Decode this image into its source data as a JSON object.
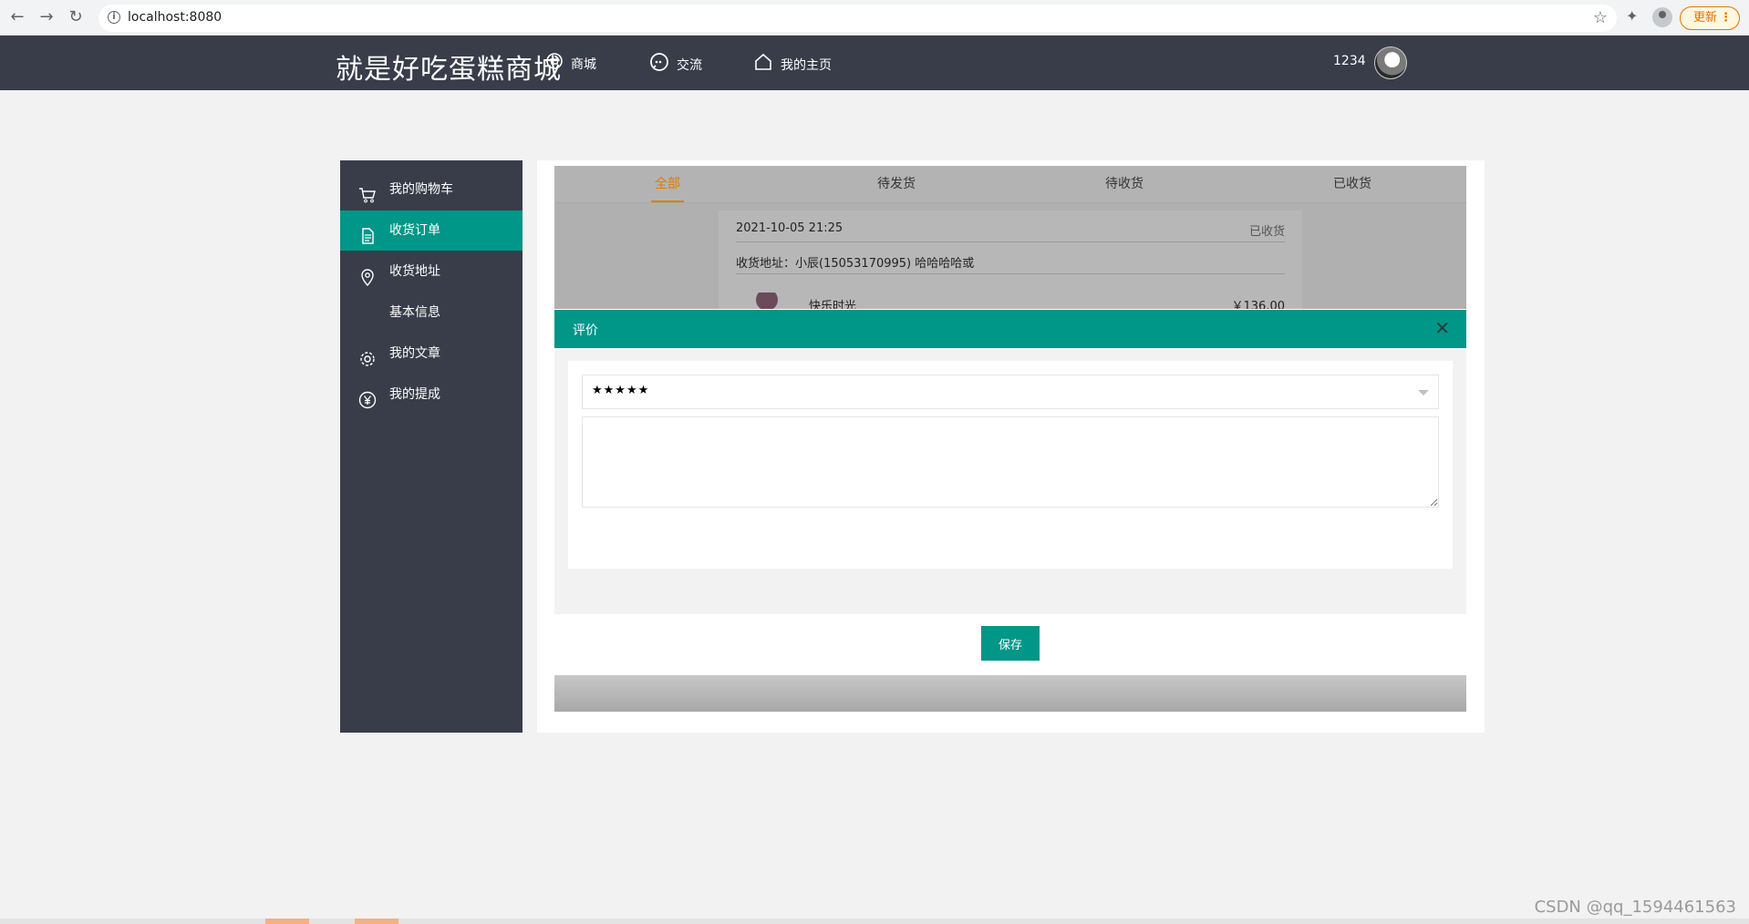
{
  "browser": {
    "url": "localhost:8080",
    "update_label": "更新",
    "update_dots": "⋮"
  },
  "header": {
    "site_title": "就是好吃蛋糕商城",
    "nav": [
      {
        "label": "商城",
        "icon": "shop-icon"
      },
      {
        "label": "交流",
        "icon": "chat-icon"
      },
      {
        "label": "我的主页",
        "icon": "home-icon"
      }
    ],
    "username": "1234"
  },
  "sidebar": {
    "items": [
      {
        "label": "我的购物车",
        "icon": "cart-icon",
        "active": false
      },
      {
        "label": "收货订单",
        "icon": "document-icon",
        "active": true
      },
      {
        "label": "收货地址",
        "icon": "location-icon",
        "active": false
      },
      {
        "label": "基本信息",
        "icon": "",
        "active": false
      },
      {
        "label": "我的文章",
        "icon": "gear-icon",
        "active": false
      },
      {
        "label": "我的提成",
        "icon": "yen-icon",
        "active": false
      }
    ]
  },
  "tabs": [
    {
      "label": "全部",
      "active": true
    },
    {
      "label": "待发货",
      "active": false
    },
    {
      "label": "待收货",
      "active": false
    },
    {
      "label": "已收货",
      "active": false
    }
  ],
  "order": {
    "datetime": "2021-10-05 21:25",
    "status": "已收货",
    "address": "收货地址：小辰(15053170995) 哈哈哈哈或",
    "product_name": "快乐时光",
    "price": "￥136.00"
  },
  "dialog": {
    "title": "评价",
    "close_glyph": "✕",
    "rating_value": "★★★★★",
    "comment_value": "",
    "save_label": "保存"
  },
  "watermark": "CSDN @qq_1594461563",
  "colors": {
    "header_bg": "#393d49",
    "accent": "#009688",
    "active_tab": "#e37b00"
  }
}
